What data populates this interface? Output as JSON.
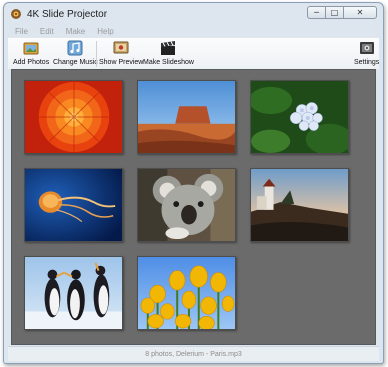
{
  "window": {
    "title": "4K Slide Projector"
  },
  "window_controls": {
    "minimize": "─",
    "maximize": "□",
    "close": "✕"
  },
  "menu": [
    "File",
    "Edit",
    "Make",
    "Help"
  ],
  "toolbar": {
    "add_photos": "Add Photos",
    "change_music": "Change Music",
    "show_preview": "Show Preview",
    "make_slideshow": "Make Slideshow",
    "settings": "Settings"
  },
  "photos": [
    {
      "subject": "orange-flower",
      "icon": "flower-photo"
    },
    {
      "subject": "desert-butte",
      "icon": "desert-photo"
    },
    {
      "subject": "hydrangea",
      "icon": "hydrangea-photo"
    },
    {
      "subject": "jellyfish",
      "icon": "jellyfish-photo"
    },
    {
      "subject": "koala",
      "icon": "koala-photo"
    },
    {
      "subject": "lighthouse",
      "icon": "lighthouse-photo"
    },
    {
      "subject": "penguins",
      "icon": "penguins-photo"
    },
    {
      "subject": "tulips",
      "icon": "tulips-photo"
    }
  ],
  "status": {
    "text": "8 photos, Delerium - Paris.mp3"
  },
  "colors": {
    "gallery_bg": "#6b6b6b",
    "window_bg": "#dde6ef"
  }
}
